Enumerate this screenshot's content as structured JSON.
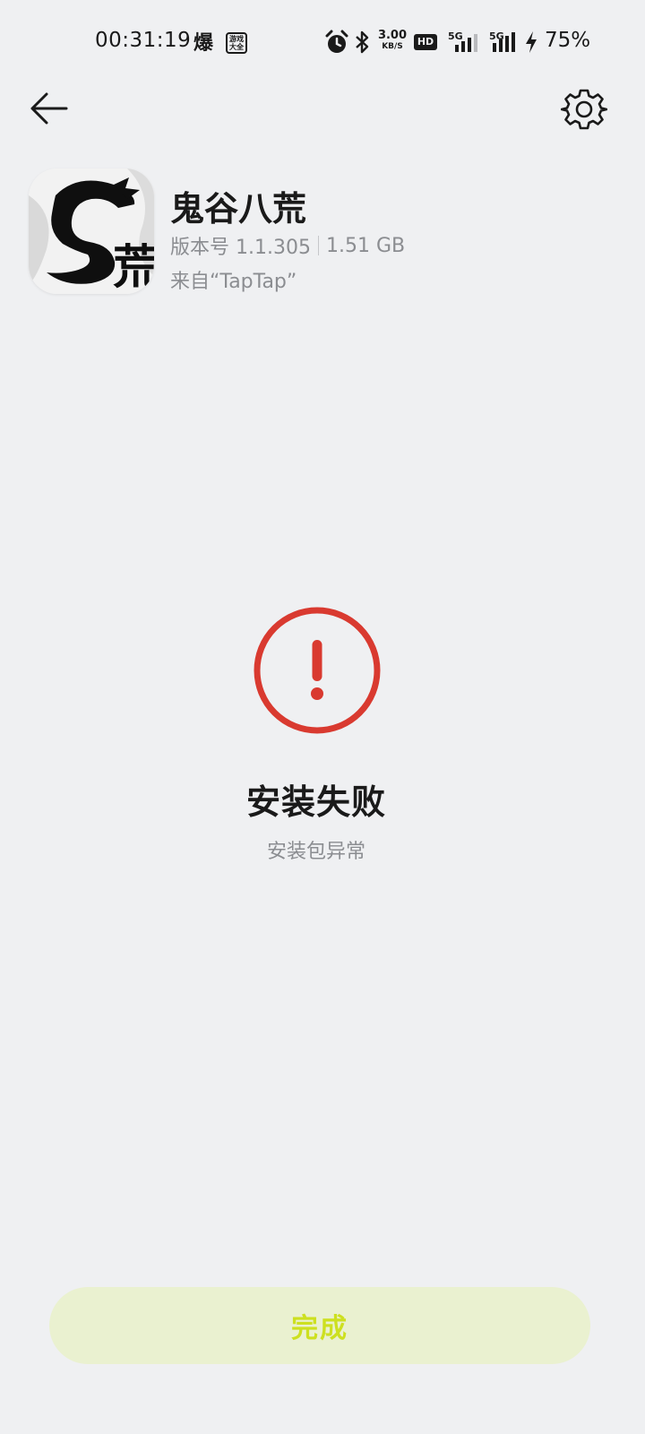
{
  "status_bar": {
    "time": "00:31:19",
    "notif_glyph": "爆",
    "notif_box_line1": "游戏",
    "notif_box_line2": "大全",
    "net_speed_value": "3.00",
    "net_speed_unit": "KB/S",
    "hd_label": "HD",
    "sim1_label": "5G",
    "sim2_label": "5G",
    "battery": "75%",
    "icons": [
      "alarm-icon",
      "bluetooth-icon",
      "signal-icon",
      "charging-icon"
    ]
  },
  "app": {
    "name": "鬼谷八荒",
    "version": "版本号 1.1.305",
    "size": "1.51 GB",
    "source": "来自“TapTap”",
    "icon_glyph": "荒"
  },
  "result": {
    "title": "安装失败",
    "subtitle": "安装包异常",
    "icon": "exclamation-circle-icon",
    "accent_color": "#d93a30"
  },
  "actions": {
    "done_label": "完成",
    "done_bg": "#eaf1d0",
    "done_text_color": "#cde020"
  }
}
